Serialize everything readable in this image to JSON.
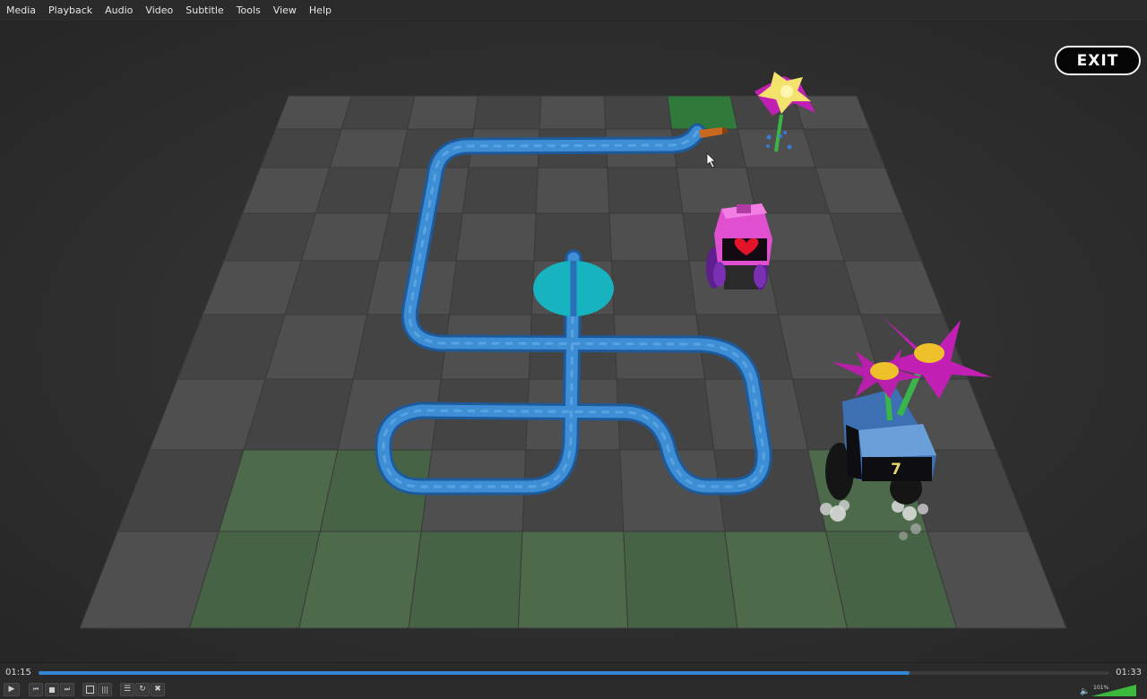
{
  "menu": [
    "Media",
    "Playback",
    "Audio",
    "Video",
    "Subtitle",
    "Tools",
    "View",
    "Help"
  ],
  "game": {
    "exit_label": "EXIT",
    "robot_badge": "7"
  },
  "player": {
    "time_elapsed": "01:15",
    "time_total": "01:33",
    "progress_fraction": 0.813,
    "volume_label": "101%",
    "volume_fraction": 1.0,
    "accent_color": "#3585d6"
  },
  "icons": {
    "play": "play-icon",
    "prev": "skip-previous-icon",
    "stop": "stop-icon",
    "next": "skip-next-icon",
    "fullscreen": "fullscreen-icon",
    "extended": "equalizer-icon",
    "playlist": "playlist-icon",
    "loop": "loop-icon",
    "shuffle": "shuffle-icon",
    "volume": "speaker-icon"
  }
}
